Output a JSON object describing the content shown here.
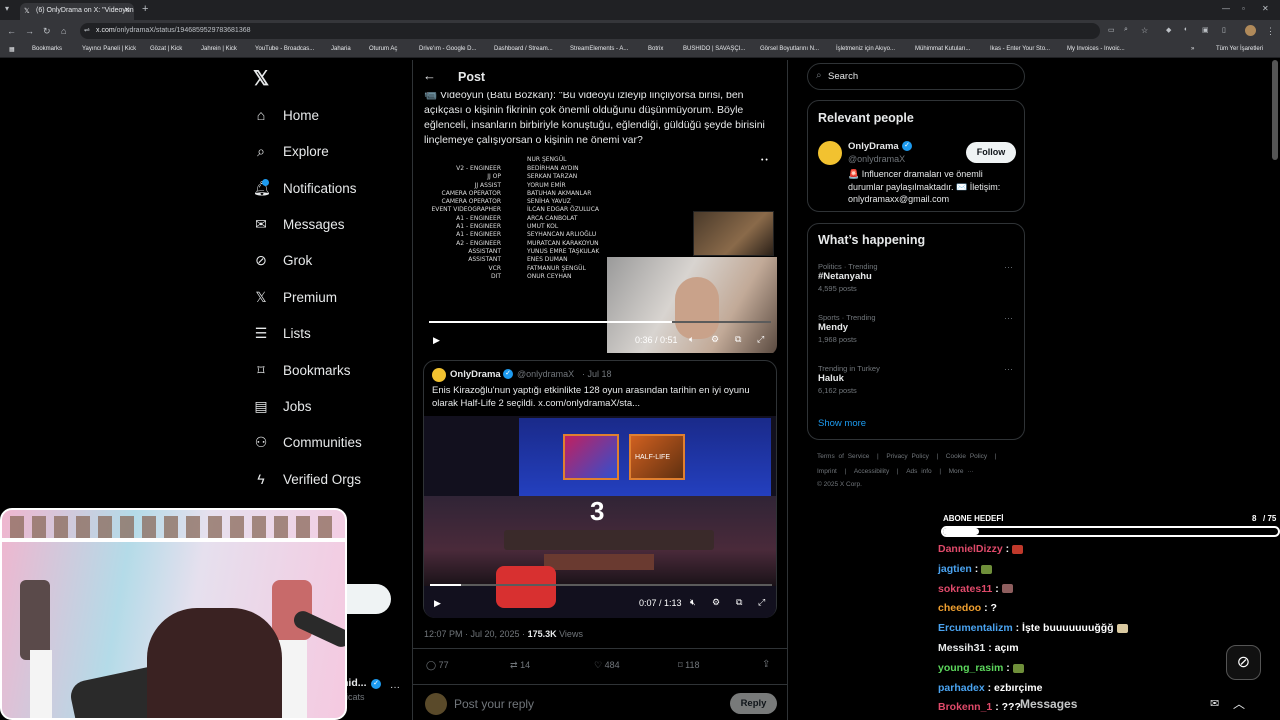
{
  "browser": {
    "tab_title": "(6) OnlyDrama on X: \"Videoyun",
    "url_host": "x.com",
    "url_path": "/onlydramaX/status/1946859529783681368",
    "bookmarks": [
      "Bookmarks",
      "Yayıncı Paneli | Kick",
      "Gözat | Kick",
      "Jahrein | Kick",
      "YouTube - Broadcas...",
      "Jaharia",
      "Oturum Aç",
      "Drive'ım - Google D...",
      "Dashboard / Stream...",
      "StreamElements - A...",
      "Botrix",
      "BUSHIDO | SAVAŞÇI...",
      "Görsel Boyutlarını N...",
      "İşletmeniz için Akıyo...",
      "Mühimmat Kutuları...",
      "Ikas - Enter Your Sto...",
      "My Invoices - Invoic..."
    ],
    "all_bookmarks": "Tüm Yer İşaretleri"
  },
  "nav": {
    "items": [
      {
        "label": "Home",
        "icon": "home-icon"
      },
      {
        "label": "Explore",
        "icon": "search-icon"
      },
      {
        "label": "Notifications",
        "icon": "bell-icon"
      },
      {
        "label": "Messages",
        "icon": "envelope-icon"
      },
      {
        "label": "Grok",
        "icon": "grok-icon"
      },
      {
        "label": "Premium",
        "icon": "x-logo-icon"
      },
      {
        "label": "Lists",
        "icon": "list-icon"
      },
      {
        "label": "Bookmarks",
        "icon": "bookmark-icon"
      },
      {
        "label": "Jobs",
        "icon": "briefcase-icon"
      },
      {
        "label": "Communities",
        "icon": "people-icon"
      },
      {
        "label": "Verified Orgs",
        "icon": "bolt-icon"
      }
    ],
    "account_name": "hid...",
    "account_handle": "icats"
  },
  "post": {
    "header": "Post",
    "text": "📹 Videoyun (Batu Bozkan): \"Bu videoyu izleyip linçliyorsa birisi, ben açıkçası o kişinin fikrinin çok önemli olduğunu düşünmüyorum. Böyle eğlenceli, insanların birbiriyle konuştuğu, eğlendiği, güldüğü şeyde birisini linçlemeye çalışıyorsan o kişinin ne önemi var?",
    "video1": {
      "time": "0:36 / 0:51",
      "progress": 0.71,
      "credits_roles": [
        "V2 - ENGINEER",
        "JJ OP",
        "JJ ASSIST",
        "CAMERA OPERATOR",
        "CAMERA OPERATOR",
        "EVENT VIDEOGRAPHER",
        "A1 - ENGINEER",
        "A1 - ENGINEER",
        "A1 - ENGINEER",
        "A2 - ENGINEER",
        "ASSISTANT",
        "ASSISTANT",
        "VCR",
        "DIT"
      ],
      "credits_names": [
        "BEDİRHAN AYDIN",
        "SERKAN TARZAN",
        "YORUM EMİR",
        "BATUHAN AKMANLAR",
        "SENİHA YAVUZ",
        "İLCAN EDGAR ÖZULUCA",
        "ARCA CANBOLAT",
        "UMUT KOL",
        "SEYHANCAN ARLIOĞLU",
        "MURATCAN KARAKOYUN",
        "YUNUS EMRE TAŞKULAK",
        "ENES DUMAN",
        "FATMANUR ŞENGÜL",
        "ONUR CEYHAN"
      ],
      "credits_top_name": "NUR ŞENGÜL"
    },
    "quote": {
      "name": "OnlyDrama",
      "handle": "@onlydramaX",
      "date": "· Jul 18",
      "text": "Enis Kirazoğlu'nun yaptığı etkinlikte 128 oyun arasından tarihin en iyi oyunu olarak Half-Life 2 seçildi.  x.com/onlydramaX/sta...",
      "video_time": "0:07 / 1:13",
      "progress": 0.09,
      "countdown": "3",
      "screen_left": "",
      "screen_right": "HALF-LIFE"
    },
    "meta_time": "12:07 PM · Jul 20, 2025 · ",
    "views_count": "175.3K",
    "views_label": " Views",
    "stats": {
      "replies": "77",
      "reposts": "14",
      "likes": "484",
      "bookmarks": "118"
    },
    "reply_placeholder": "Post your reply",
    "reply_button": "Reply"
  },
  "right": {
    "search_placeholder": "Search",
    "relevant_title": "Relevant people",
    "person": {
      "name": "OnlyDrama",
      "handle": "@onlydramaX",
      "bio": "🚨 Influencer dramaları ve önemli durumlar paylaşılmaktadır. ✉️ İletişim: onlydramaxx@gmail.com",
      "follow": "Follow"
    },
    "happening_title": "What’s happening",
    "trends": [
      {
        "category": "Politics · Trending",
        "name": "#Netanyahu",
        "posts": "4,595 posts"
      },
      {
        "category": "Sports · Trending",
        "name": "Mendy",
        "posts": "1,968 posts"
      },
      {
        "category": "Trending in Turkey",
        "name": "Haluk",
        "posts": "6,162 posts"
      }
    ],
    "show_more": "Show more",
    "footer_line1": [
      "Terms of Service",
      "|",
      "Privacy Policy",
      "|",
      "Cookie Policy",
      "|"
    ],
    "footer_line2": [
      "Imprint",
      "|",
      "Accessibility",
      "|",
      "Ads info",
      "|",
      "More ···"
    ],
    "copyright": "© 2025 X Corp."
  },
  "overlay": {
    "goal_label": "ABONE HEDEFİ",
    "goal_value": "8",
    "goal_total": "/ 75",
    "goal_progress": 0.107,
    "chat": [
      {
        "user": "DannielDizzy",
        "color": "#e04a6a",
        "msg": " : ",
        "emote": "#c0392b"
      },
      {
        "user": "jagtien",
        "color": "#4aa3f0",
        "msg": " : ",
        "emote": "#6f8f3a"
      },
      {
        "user": "sokrates11",
        "color": "#e04a6a",
        "msg": " : ",
        "emote": "#8e5e5e"
      },
      {
        "user": "cheedoo",
        "color": "#f0a030",
        "msg": " : ?",
        "emote": ""
      },
      {
        "user": "Ercumentalizm",
        "color": "#4aa3f0",
        "msg": " : İşte buuuuuuuğğğ ",
        "emote": "#d9c9a0"
      },
      {
        "user": "Messih31",
        "color": "#e7e9ea",
        "msg": " : açım",
        "emote": ""
      },
      {
        "user": "young_rasim",
        "color": "#5cd65c",
        "msg": " : ",
        "emote": "#6f8f3a"
      },
      {
        "user": "parhadex",
        "color": "#4aa3f0",
        "msg": " : ezbırçime",
        "emote": ""
      },
      {
        "user": "Brokenn_1",
        "color": "#e04a6a",
        "msg": " : ???",
        "emote": ""
      }
    ],
    "messages_label": "Messages"
  },
  "colors": {
    "accent": "#1d9bf0",
    "bg": "#000000",
    "border": "#2f3336",
    "muted": "#71767b"
  }
}
